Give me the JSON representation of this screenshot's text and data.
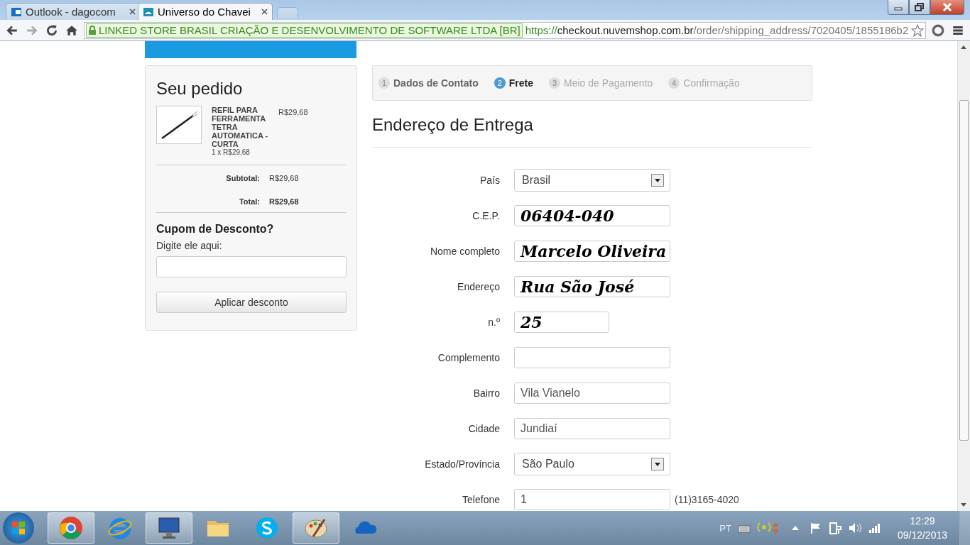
{
  "browser": {
    "tabs": [
      {
        "title": "Outlook - dagocom",
        "selected": false
      },
      {
        "title": "Universo do Chavei",
        "selected": true
      }
    ],
    "address": {
      "identity": "LINKED STORE BRASIL CRIAÇÃO E DESENVOLVIMENTO DE SOFTWARE LTDA [BR]",
      "scheme": "https://",
      "host": "checkout.nuvemshop.com.br",
      "path": "/order/shipping_address/7020405/1855186b2"
    }
  },
  "order": {
    "title": "Seu pedido",
    "items": [
      {
        "name": "REFIL PARA FERRAMENTA TETRA AUTOMATICA - CURTA",
        "quantity": "1 x R$29,68",
        "price": "R$29,68"
      }
    ],
    "subtotal_label": "Subtotal:",
    "subtotal": "R$29,68",
    "total_label": "Total:",
    "total": "R$29,68",
    "coupon": {
      "title": "Cupom de Desconto?",
      "hint": "Digite ele aqui:",
      "button": "Aplicar desconto"
    }
  },
  "steps": [
    {
      "number": "1",
      "label": "Dados de Contato",
      "completed": true,
      "selected": false
    },
    {
      "number": "2",
      "label": "Frete",
      "completed": false,
      "selected": true
    },
    {
      "number": "3",
      "label": "Meio de Pagamento",
      "completed": false,
      "selected": false
    },
    {
      "number": "4",
      "label": "Confirmação",
      "completed": false,
      "selected": false
    }
  ],
  "form": {
    "title": "Endereço de Entrega",
    "fields": [
      {
        "label": "País",
        "kind": "select",
        "value": "Brasil"
      },
      {
        "label": "C.E.P.",
        "kind": "handwritten",
        "value": "06404-040"
      },
      {
        "label": "Nome completo",
        "kind": "handwritten",
        "value": "Marcelo Oliveira"
      },
      {
        "label": "Endereço",
        "kind": "handwritten",
        "value": "Rua São José"
      },
      {
        "label": "n.º",
        "kind": "handwritten",
        "value": "25",
        "short": true
      },
      {
        "label": "Complemento",
        "kind": "text"
      },
      {
        "label": "Bairro",
        "kind": "text",
        "value": "Vila Vianelo"
      },
      {
        "label": "Cidade",
        "kind": "text",
        "value": "Jundiaí"
      },
      {
        "label": "Estado/Província",
        "kind": "select",
        "value": "São Paulo"
      },
      {
        "label": "Telefone",
        "kind": "text",
        "value": "1",
        "note": "(11)3165-4020"
      }
    ]
  },
  "taskbar": {
    "apps": [
      {
        "kind": "chrome",
        "open": true
      },
      {
        "kind": "ie",
        "open": false
      },
      {
        "kind": "remote",
        "open": true
      },
      {
        "kind": "folder",
        "open": false
      },
      {
        "kind": "skype",
        "open": false
      },
      {
        "kind": "paint",
        "open": true
      },
      {
        "kind": "cloud",
        "open": false
      }
    ],
    "language": "PT",
    "time": "12:29",
    "date": "09/12/2013"
  }
}
